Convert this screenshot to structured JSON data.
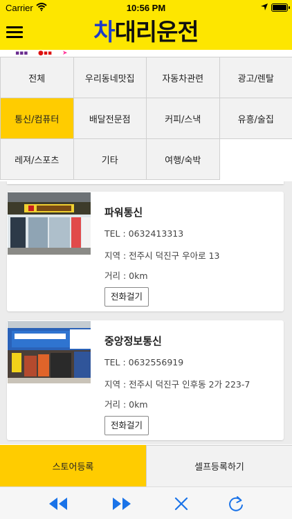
{
  "status_bar": {
    "carrier": "Carrier",
    "time": "10:56 PM"
  },
  "header": {
    "title_accent": "차",
    "title_rest": "대리운전"
  },
  "colors": {
    "brand_yellow": "#fde600",
    "active_yellow": "#ffcc00",
    "accent_blue": "#1e3cc8",
    "toolbar_blue": "#1a73e8"
  },
  "categories": [
    {
      "label": "전체",
      "active": false
    },
    {
      "label": "우리동네맛집",
      "active": false
    },
    {
      "label": "자동차관련",
      "active": false
    },
    {
      "label": "광고/렌탈",
      "active": false
    },
    {
      "label": "통신/컴퓨터",
      "active": true
    },
    {
      "label": "배달전문점",
      "active": false
    },
    {
      "label": "커피/스낵",
      "active": false
    },
    {
      "label": "유흥/술집",
      "active": false
    },
    {
      "label": "레져/스포츠",
      "active": false
    },
    {
      "label": "기타",
      "active": false
    },
    {
      "label": "여행/숙박",
      "active": false
    }
  ],
  "stores": [
    {
      "name": "파워통신",
      "tel": "TEL : 0632413313",
      "region": "지역 : 전주시 덕진구 우아로 13",
      "distance": "거리 : 0km",
      "call_label": "전화걸기"
    },
    {
      "name": "중앙정보통신",
      "tel": "TEL : 0632556919",
      "region": "지역 : 전주시 덕진구 인후동 2가 223-7",
      "distance": "거리 : 0km",
      "call_label": "전화걸기"
    }
  ],
  "bottom": {
    "store_register": "스토어등록",
    "self_register": "셀프등록하기"
  },
  "toolbar": {
    "icons": [
      "rewind-icon",
      "fast-forward-icon",
      "close-icon",
      "refresh-icon"
    ]
  }
}
